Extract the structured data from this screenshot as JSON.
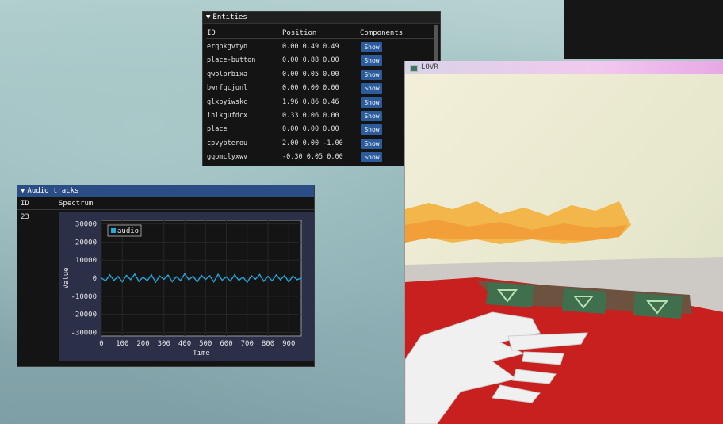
{
  "entities": {
    "title": "Entities",
    "columns": [
      "ID",
      "Position",
      "Components"
    ],
    "rows": [
      {
        "id": "erqbkgvtyn",
        "position": "0.00 0.49 0.49",
        "button": "Show"
      },
      {
        "id": "place-button",
        "position": "0.00 0.88 0.00",
        "button": "Show"
      },
      {
        "id": "qwolprbixa",
        "position": "0.00 0.05 0.00",
        "button": "Show"
      },
      {
        "id": "bwrfqcjonl",
        "position": "0.00 0.00 0.00",
        "button": "Show"
      },
      {
        "id": "glxpyiwskc",
        "position": "1.96 0.86 0.46",
        "button": "Show"
      },
      {
        "id": "ihlkgufdcx",
        "position": "0.33 0.06 0.00",
        "button": "Show"
      },
      {
        "id": "place",
        "position": "0.00 0.00 0.00",
        "button": "Show"
      },
      {
        "id": "cpvybterou",
        "position": "2.00 0.00 -1.00",
        "button": "Show"
      },
      {
        "id": "gqomclyxwv",
        "position": "-0.30 0.05 0.00",
        "button": "Show"
      }
    ]
  },
  "audio_tracks": {
    "title": "Audio tracks",
    "columns": [
      "ID",
      "Spectrum"
    ],
    "track_id": "23"
  },
  "lovr_window": {
    "title": "LOVR"
  },
  "chart_data": {
    "type": "line",
    "title": "",
    "xlabel": "Time",
    "ylabel": "Value",
    "xlim": [
      0,
      960
    ],
    "ylim": [
      -32000,
      32000
    ],
    "xticks": [
      0,
      100,
      200,
      300,
      400,
      500,
      600,
      700,
      800,
      900
    ],
    "yticks": [
      30000,
      20000,
      10000,
      0,
      -10000,
      -20000,
      -30000
    ],
    "legend": "top-left",
    "series": [
      {
        "name": "audio",
        "color": "#2aa9e0",
        "x": [
          0,
          20,
          40,
          60,
          80,
          100,
          120,
          140,
          160,
          180,
          200,
          220,
          240,
          260,
          280,
          300,
          320,
          340,
          360,
          380,
          400,
          420,
          440,
          460,
          480,
          500,
          520,
          540,
          560,
          580,
          600,
          620,
          640,
          660,
          680,
          700,
          720,
          740,
          760,
          780,
          800,
          820,
          840,
          860,
          880,
          900,
          920,
          940,
          960
        ],
        "values": [
          0,
          -1500,
          1800,
          -1200,
          900,
          -2000,
          1500,
          -800,
          2200,
          -1800,
          600,
          -1400,
          1900,
          -2200,
          1200,
          -600,
          1700,
          -1900,
          800,
          -1300,
          2400,
          -900,
          1100,
          -2100,
          1600,
          -700,
          1300,
          -2000,
          2100,
          -1100,
          700,
          -1600,
          1900,
          -1200,
          600,
          -2300,
          1400,
          -500,
          2000,
          -1700,
          1000,
          -1400,
          1800,
          -900,
          1500,
          -2100,
          1200,
          -800,
          0
        ]
      }
    ]
  }
}
